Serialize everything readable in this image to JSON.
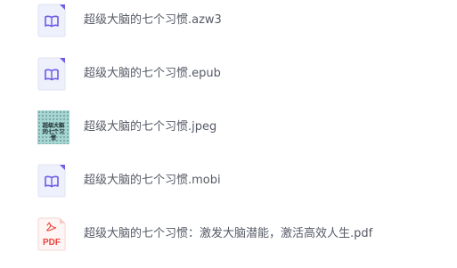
{
  "files": [
    {
      "name": "超级大脑的七个习惯.azw3",
      "type": "ebook",
      "icon": "book-file-icon"
    },
    {
      "name": "超级大脑的七个习惯.epub",
      "type": "ebook",
      "icon": "book-file-icon"
    },
    {
      "name": "超级大脑的七个习惯.jpeg",
      "type": "image",
      "icon": "image-thumbnail",
      "thumb_text": "超级大脑的七个习惯"
    },
    {
      "name": "超级大脑的七个习惯.mobi",
      "type": "ebook",
      "icon": "book-file-icon"
    },
    {
      "name": "超级大脑的七个习惯：激发大脑潜能，激活高效人生.pdf",
      "type": "pdf",
      "icon": "pdf-file-icon",
      "icon_label": "PDF"
    }
  ],
  "colors": {
    "ebook_icon_bg": "#eef0fb",
    "ebook_icon_stroke": "#6b5ce7",
    "pdf_icon_red": "#e8443a",
    "file_name_text": "#555a66"
  }
}
